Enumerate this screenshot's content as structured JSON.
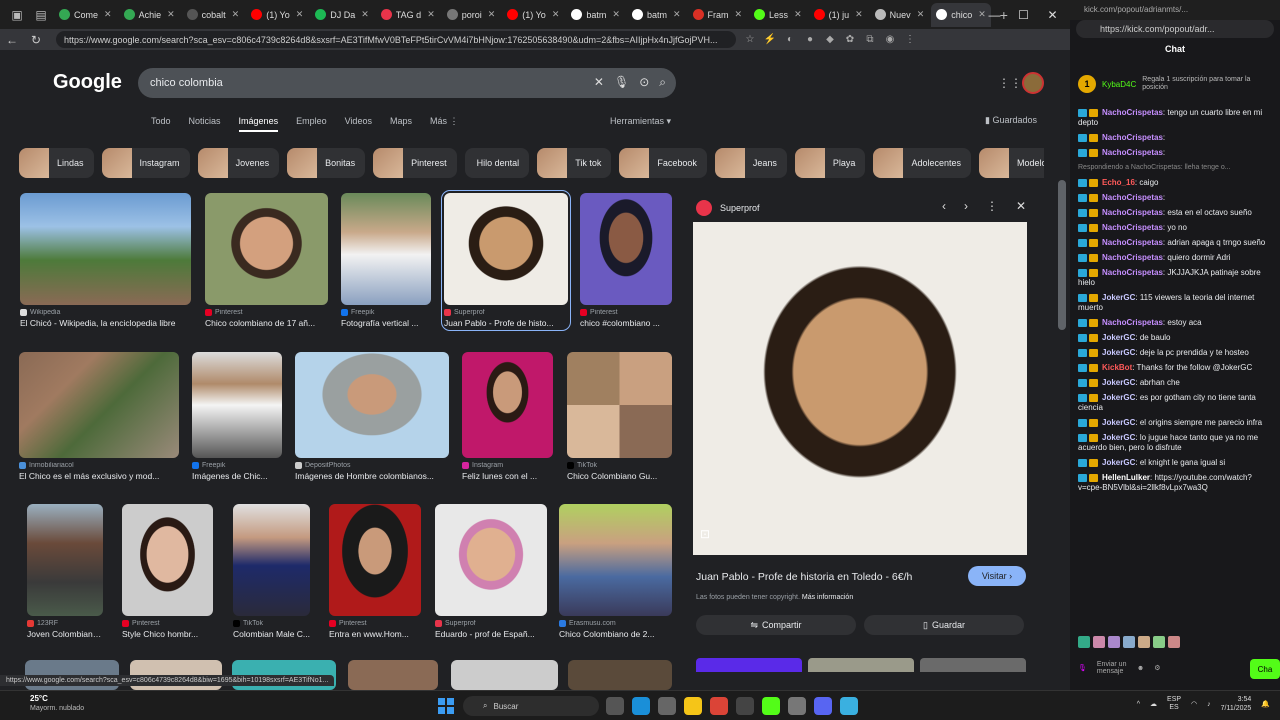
{
  "browser": {
    "tabs": [
      {
        "label": "Come",
        "color": "#34a853"
      },
      {
        "label": "Achie",
        "color": "#34a853"
      },
      {
        "label": "cobalt",
        "color": "#555555"
      },
      {
        "label": "(1) Yo",
        "color": "#ff0000"
      },
      {
        "label": "DJ Da",
        "color": "#1db954"
      },
      {
        "label": "TAG d",
        "color": "#e8344a"
      },
      {
        "label": "poroi",
        "color": "#777777"
      },
      {
        "label": "(1) Yo",
        "color": "#ff0000"
      },
      {
        "label": "batm",
        "color": "#ffffff"
      },
      {
        "label": "batm",
        "color": "#ffffff"
      },
      {
        "label": "Fram",
        "color": "#d93025"
      },
      {
        "label": "Less",
        "color": "#53fc18"
      },
      {
        "label": "(1) ju",
        "color": "#ff0000"
      },
      {
        "label": "Nuev",
        "color": "#bbbbbb"
      },
      {
        "label": "chico",
        "color": "#ffffff"
      }
    ],
    "url": "https://www.google.com/search?sca_esv=c806c4739c8264d8&sxsrf=AE3TifMfwV0BTeFPt5tirCvVM4i7bHNjow:1762505638490&udm=2&fbs=AIIjpHx4nJjfGojPVH..."
  },
  "google": {
    "logo": "Google",
    "query": "chico colombia",
    "tabs": [
      "Todo",
      "Noticias",
      "Imágenes",
      "Empleo",
      "Videos",
      "Maps",
      "Más"
    ],
    "active_tab": "Imágenes",
    "tools": "Herramientas",
    "saved": "Guardados",
    "chips": [
      "Lindas",
      "Instagram",
      "Jovenes",
      "Bonitas",
      "Pinterest",
      "Hilo dental",
      "Tik tok",
      "Facebook",
      "Jeans",
      "Playa",
      "Adolecentes",
      "Modelos"
    ],
    "results_row1": [
      {
        "source": "Wikipedia",
        "title": "El Chicó - Wikipedia, la enciclopedia libre"
      },
      {
        "source": "Pinterest",
        "title": "Chico colombiano de 17 añ..."
      },
      {
        "source": "Freepik",
        "title": "Fotografía vertical ..."
      },
      {
        "source": "Superprof",
        "title": "Juan Pablo - Profe de histo..."
      },
      {
        "source": "Pinterest",
        "title": "chico #colombiano ..."
      }
    ],
    "results_row2": [
      {
        "source": "Inmobiliariacol",
        "title": "El Chico es el más exclusivo y mod..."
      },
      {
        "source": "Freepik",
        "title": "Imágenes de Chic..."
      },
      {
        "source": "DepositPhotos",
        "title": "Imágenes de Hombre colombianos..."
      },
      {
        "source": "Instagram",
        "title": "Feliz lunes con el ..."
      },
      {
        "source": "TikTok",
        "title": "Chico Colombiano Gu..."
      }
    ],
    "results_row3": [
      {
        "source": "123RF",
        "title": "Joven Colombiano..."
      },
      {
        "source": "Pinterest",
        "title": "Style Chico hombr..."
      },
      {
        "source": "TikTok",
        "title": "Colombian Male C..."
      },
      {
        "source": "Pinterest",
        "title": "Entra en www.Hom..."
      },
      {
        "source": "Superprof",
        "title": "Eduardo - prof de Españ..."
      },
      {
        "source": "Erasmusu.com",
        "title": "Chico Colombiano de 2..."
      }
    ],
    "preview": {
      "source": "Superprof",
      "title": "Juan Pablo - Profe de historia en Toledo - 6€/h",
      "visit": "Visitar",
      "copyright": "Las fotos pueden tener copyright.",
      "more_info": "Más información",
      "share": "Compartir",
      "save": "Guardar"
    },
    "status_url": "https://www.google.com/search?sca_esv=c806c4739c8264d8&biw=1695&bih=10198sxsrf=AE3TifNo1..."
  },
  "kick": {
    "url": "kick.com/popout/adrianmts/...",
    "url_bar": "https://kick.com/popout/adr...",
    "chat_label": "Chat",
    "pinned": {
      "count": "1",
      "user": "KybaD4C",
      "text": "Regala 1 suscripción para tomar la posición"
    },
    "messages": [
      {
        "user": "NachoCrispetas",
        "color": "#c68fff",
        "text": "tengo un cuarto libre en mi depto"
      },
      {
        "user": "NachoCrispetas",
        "color": "#c68fff",
        "text": ""
      },
      {
        "user": "NachoCrispetas",
        "color": "#c68fff",
        "text": ""
      },
      {
        "user": "Echo_16",
        "color": "#ff5a5a",
        "text": "caigo",
        "reply": "Respondiendo a NachoCrispetas: lleha tenge o..."
      },
      {
        "user": "NachoCrispetas",
        "color": "#c68fff",
        "text": ""
      },
      {
        "user": "NachoCrispetas",
        "color": "#c68fff",
        "text": "esta en el octavo sueño"
      },
      {
        "user": "NachoCrispetas",
        "color": "#c68fff",
        "text": "yo no"
      },
      {
        "user": "NachoCrispetas",
        "color": "#c68fff",
        "text": "adrian apaga q trngo sueño"
      },
      {
        "user": "NachoCrispetas",
        "color": "#c68fff",
        "text": "quiero dormir Adri"
      },
      {
        "user": "NachoCrispetas",
        "color": "#c68fff",
        "text": "JKJJAJKJA patinaje sobre hielo"
      },
      {
        "user": "JokerGC",
        "color": "#c8c8ff",
        "text": "115 viewers la teoria del internet muerto"
      },
      {
        "user": "NachoCrispetas",
        "color": "#c68fff",
        "text": "estoy aca"
      },
      {
        "user": "JokerGC",
        "color": "#c8c8ff",
        "text": "de baulo"
      },
      {
        "user": "JokerGC",
        "color": "#c8c8ff",
        "text": "deje la pc prendida y te hosteo"
      },
      {
        "user": "KickBot",
        "color": "#ff5a5a",
        "text": "Thanks for the follow @JokerGC"
      },
      {
        "user": "JokerGC",
        "color": "#c8c8ff",
        "text": "abrhan che"
      },
      {
        "user": "JokerGC",
        "color": "#c8c8ff",
        "text": "es por gotham city no tiene tanta ciencia"
      },
      {
        "user": "JokerGC",
        "color": "#c8c8ff",
        "text": "el origins siempre me parecio infra"
      },
      {
        "user": "JokerGC",
        "color": "#c8c8ff",
        "text": "lo jugue hace tanto que ya no me acuerdo bien, pero lo disfrute"
      },
      {
        "user": "JokerGC",
        "color": "#c8c8ff",
        "text": "el knight le gana igual si"
      },
      {
        "user": "HellenLulker",
        "color": "#ffffff",
        "text": "https://youtube.com/watch?v=cpe-BN5Vlbl&si=2llkf8vLpx7wa3Q"
      }
    ],
    "input_placeholder": "Enviar un mensaje",
    "send": "Cha"
  },
  "taskbar": {
    "temp": "25°C",
    "weather": "Mayorm. nublado",
    "search": "Buscar",
    "lang": "ESP",
    "lang2": "ES",
    "time": "3:54",
    "date": "7/11/2025"
  }
}
